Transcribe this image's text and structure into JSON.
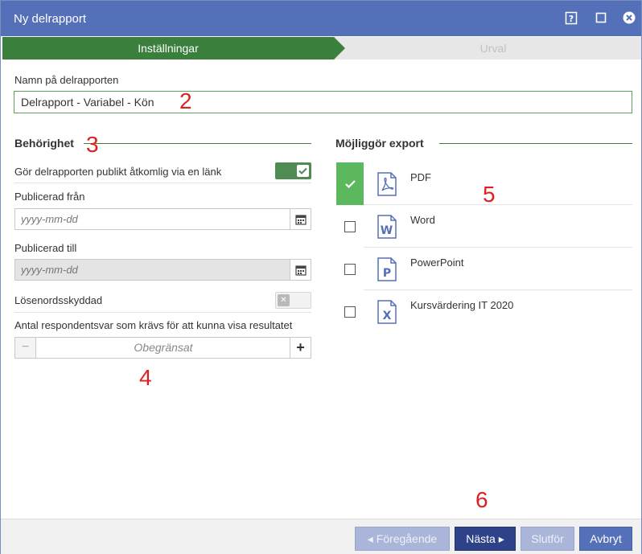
{
  "window": {
    "title": "Ny delrapport"
  },
  "steps": {
    "active": "Inställningar",
    "inactive": "Urval"
  },
  "name_field": {
    "label": "Namn på delrapporten",
    "value": "Delrapport - Variabel - Kön"
  },
  "permissions": {
    "title": "Behörighet",
    "public_link_label": "Gör delrapporten publikt åtkomlig via en länk",
    "public_link_enabled": true,
    "published_from_label": "Publicerad från",
    "published_from_placeholder": "yyyy-mm-dd",
    "published_to_label": "Publicerad till",
    "published_to_placeholder": "yyyy-mm-dd",
    "password_label": "Lösenordsskyddad",
    "password_enabled": false,
    "respondents_label": "Antal respondentsvar som krävs för att kunna visa resultatet",
    "respondents_value": "Obegränsat",
    "minus": "−",
    "plus": "+"
  },
  "export": {
    "title": "Möjliggör export",
    "items": [
      {
        "name": "PDF",
        "checked": true,
        "icon": "pdf-icon"
      },
      {
        "name": "Word",
        "checked": false,
        "icon": "word-icon"
      },
      {
        "name": "PowerPoint",
        "checked": false,
        "icon": "powerpoint-icon"
      },
      {
        "name": "Kursvärdering IT 2020",
        "checked": false,
        "icon": "excel-icon"
      }
    ]
  },
  "annotations": {
    "n2": "2",
    "n3": "3",
    "n4": "4",
    "n5": "5",
    "n6": "6"
  },
  "footer": {
    "prev": "Föregående",
    "next": "Nästa",
    "finish": "Slutför",
    "cancel": "Avbryt"
  },
  "colors": {
    "titlebar": "#5470b8",
    "step_active": "#3a7f3c",
    "checked": "#5cb85c",
    "annotation": "#e02020"
  }
}
